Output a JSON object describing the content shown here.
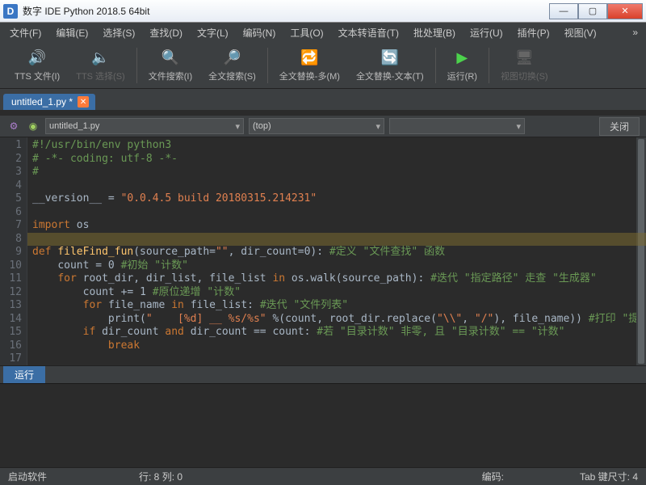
{
  "window": {
    "title": "数字 IDE Python 2018.5 64bit"
  },
  "menu": {
    "items": [
      "文件(F)",
      "编辑(E)",
      "选择(S)",
      "查找(D)",
      "文字(L)",
      "编码(N)",
      "工具(O)",
      "文本转语音(T)",
      "批处理(B)",
      "运行(U)",
      "插件(P)",
      "视图(V)"
    ]
  },
  "toolbar": {
    "tts_file": "TTS 文件(I)",
    "tts_select": "TTS 选择(S)",
    "file_search": "文件搜索(I)",
    "full_search": "全文搜索(S)",
    "replace_multi": "全文替换-多(M)",
    "replace_text": "全文替换-文本(T)",
    "run": "运行(R)",
    "view_switch": "视图切换(S)"
  },
  "tabs": {
    "file": "untitled_1.py *"
  },
  "nav": {
    "file": "untitled_1.py",
    "scope": "(top)",
    "close": "关闭"
  },
  "code": {
    "lines": [
      {
        "raw": "#!/usr/bin/env python3",
        "cls": "k-green"
      },
      {
        "raw": "# -*- coding: utf-8 -*-",
        "cls": "k-green"
      },
      {
        "raw": "#",
        "cls": "k-green"
      },
      {
        "raw": ""
      },
      {
        "html": "<span class='k-name'>__version__ = </span><span class='k-str'>\"0.0.4.5 build 20180315.214231\"</span>"
      },
      {
        "raw": ""
      },
      {
        "html": "<span class='k-kw'>import</span> <span class='k-name'>os</span>"
      },
      {
        "raw": ""
      },
      {
        "html": "<span class='k-kw'>def</span> <span class='k-def'>fileFind_fun</span><span class='k-name'>(source_path=</span><span class='k-str'>\"\"</span><span class='k-name'>, dir_count=</span><span class='k-name'>0</span><span class='k-name'>):</span> <span class='k-green'>#定义 \"文件查找\" 函数</span>"
      },
      {
        "html": "    <span class='k-name'>count = 0</span> <span class='k-green'>#初始 \"计数\"</span>"
      },
      {
        "html": "    <span class='k-kw'>for</span> <span class='k-name'>root_dir, dir_list, file_list</span> <span class='k-kw'>in</span> <span class='k-name'>os.walk(source_path):</span> <span class='k-green'>#迭代 \"指定路径\" 走查 \"生成器\"</span>"
      },
      {
        "html": "        <span class='k-name'>count += 1</span> <span class='k-green'>#原位递增 \"计数\"</span>"
      },
      {
        "html": "        <span class='k-kw'>for</span> <span class='k-name'>file_name</span> <span class='k-kw'>in</span> <span class='k-name'>file_list:</span> <span class='k-green'>#迭代 \"文件列表\"</span>"
      },
      {
        "html": "            <span class='k-name'>print(</span><span class='k-str'>\"    [%d] __ %s/%s\"</span> <span class='k-name'>%(count, root_dir.replace(</span><span class='k-str'>\"\\\\\"</span><span class='k-name'>, </span><span class='k-str'>\"/\"</span><span class='k-name'>), file_name))</span> <span class='k-green'>#打印 \"提示信息\"</span>"
      },
      {
        "html": "        <span class='k-kw'>if</span> <span class='k-name'>dir_count</span> <span class='k-kw'>and</span> <span class='k-name'>dir_count == count:</span> <span class='k-green'>#若 \"目录计数\" 非零, 且 \"目录计数\" == \"计数\"</span>"
      },
      {
        "html": "            <span class='k-kw'>break</span>"
      },
      {
        "raw": ""
      }
    ]
  },
  "runpanel": {
    "label": "运行"
  },
  "status": {
    "left": "启动软件",
    "pos": "行: 8  列: 0",
    "encoding": "编码:",
    "tab": "Tab 键尺寸: 4"
  }
}
